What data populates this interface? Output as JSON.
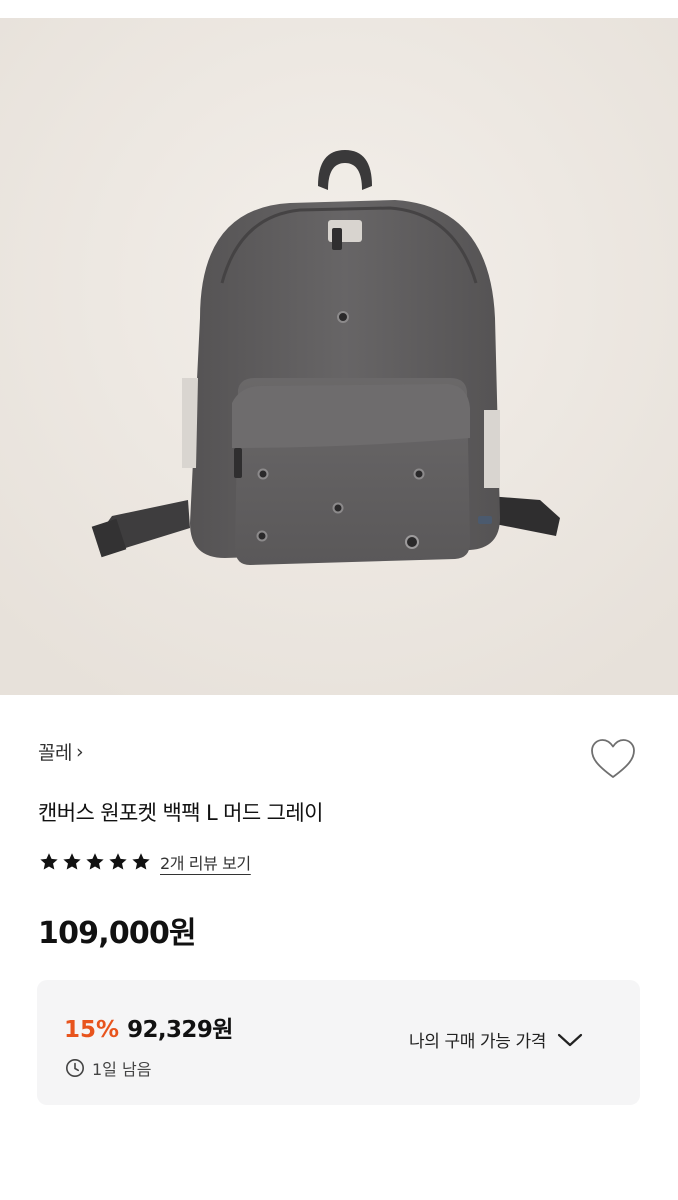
{
  "product": {
    "image_alt": "canvas-backpack-photo",
    "brand": "꼴레",
    "brand_chevron": "›",
    "title": "캔버스 원포켓 백팩 L 머드 그레이",
    "rating": 5,
    "review_link": "2개 리뷰 보기",
    "price": "109,000원"
  },
  "discount": {
    "percent": "15%",
    "sale_price": "92,329원",
    "remaining": "1일 남음",
    "my_price_label": "나의 구매 가능 가격"
  },
  "colors": {
    "accent": "#e8541d",
    "box_bg": "#f5f5f6",
    "hero_bg": "#efebe6"
  },
  "icons": {
    "like": "heart-outline-icon",
    "star": "star-filled-icon",
    "clock": "clock-icon",
    "expand": "chevron-down-icon"
  }
}
